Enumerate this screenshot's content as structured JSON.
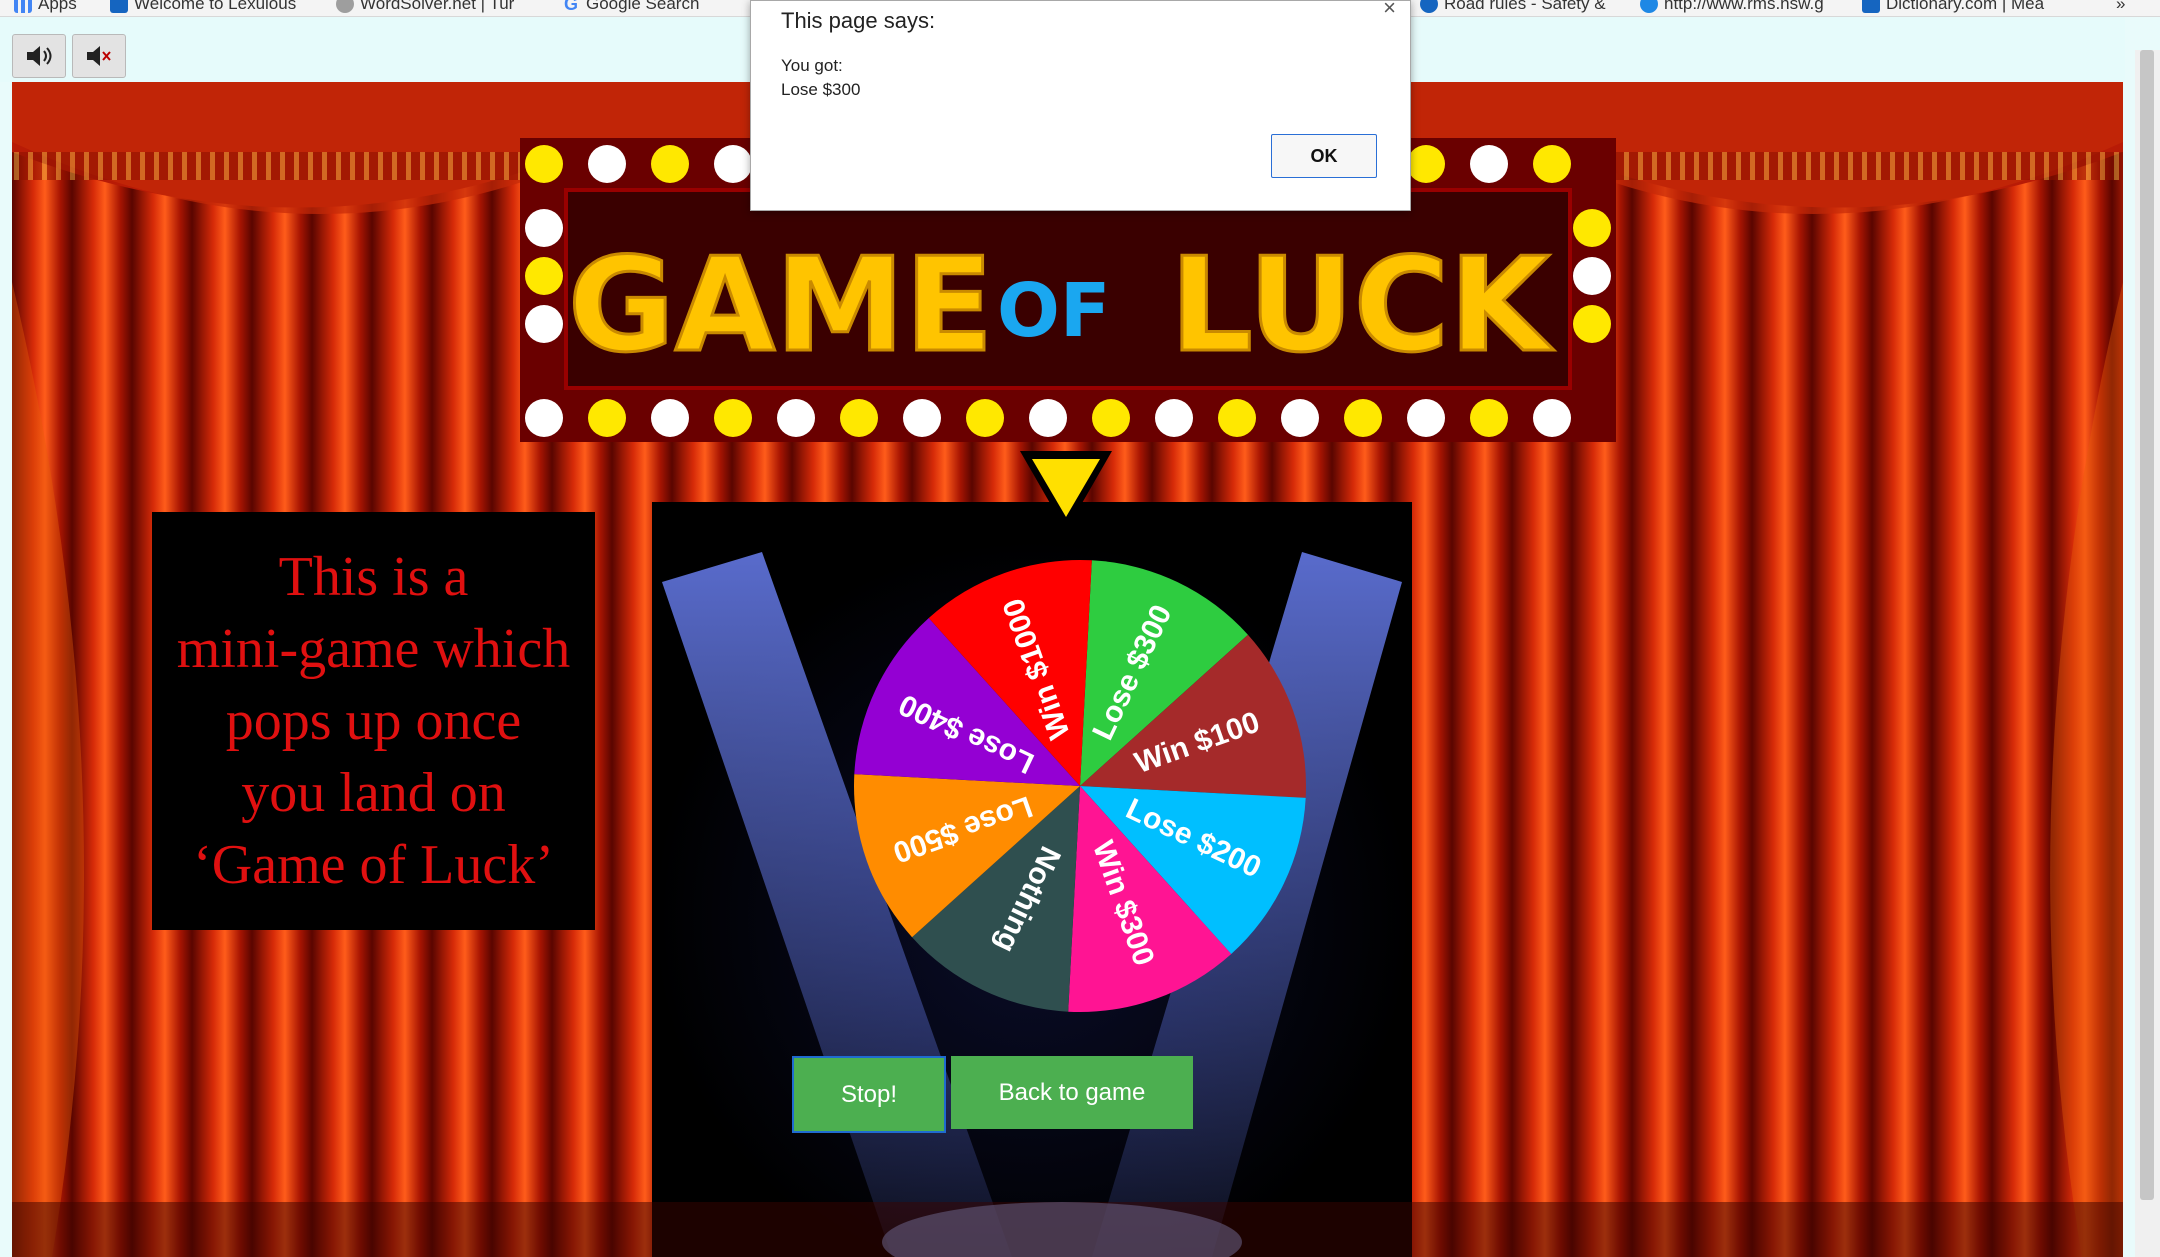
{
  "bookmarks": [
    {
      "label": "Apps",
      "icon": "apps-grid-icon",
      "color": "#4285f4"
    },
    {
      "label": "Welcome to Lexulous",
      "icon": "lexulous-icon",
      "color": "#1565c0"
    },
    {
      "label": "WordSolver.net | Tur",
      "icon": "wordsolver-icon",
      "color": "#9e9e9e"
    },
    {
      "label": "Google Search",
      "icon": "google-icon",
      "color": "#4285f4"
    },
    {
      "label": "Road rules - Safety &",
      "icon": "nsw-icon",
      "color": "#1565c0"
    },
    {
      "label": "http://www.rms.nsw.g",
      "icon": "rms-icon",
      "color": "#1e88e5"
    },
    {
      "label": "Dictionary.com | Mea",
      "icon": "dictionary-icon",
      "color": "#1565c0"
    },
    {
      "label": "»",
      "icon": "overflow-chevron-icon",
      "color": "#333"
    }
  ],
  "sound": {
    "on_icon": "speaker-on-icon",
    "mute_icon": "speaker-mute-icon"
  },
  "title_sign": {
    "word1": "GAME",
    "word2": "OF",
    "word3": "LUCK",
    "yellow": "#ffc400",
    "blue": "#1aa7f0"
  },
  "info_box": {
    "lines": [
      "This is a",
      "mini-game which",
      "pops up once",
      "you land on",
      "‘Game of Luck’"
    ]
  },
  "wheel": {
    "segments": [
      {
        "label": "Lose $300",
        "color": "#2ecc40"
      },
      {
        "label": "Win $100",
        "color": "#a52a2a"
      },
      {
        "label": "Lose $200",
        "color": "#00bfff"
      },
      {
        "label": "Win $300",
        "color": "#ff1493"
      },
      {
        "label": "Nothing",
        "color": "#2f4f4f"
      },
      {
        "label": "Lose $500",
        "color": "#ff8c00"
      },
      {
        "label": "Lose $400",
        "color": "#9400d3"
      },
      {
        "label": "Win $1000",
        "color": "#ff0000"
      }
    ]
  },
  "buttons": {
    "stop": "Stop!",
    "back": "Back to game"
  },
  "dialog": {
    "title": "This page says:",
    "close": "×",
    "line1": "You got:",
    "line2": "Lose $300",
    "ok": "OK"
  }
}
